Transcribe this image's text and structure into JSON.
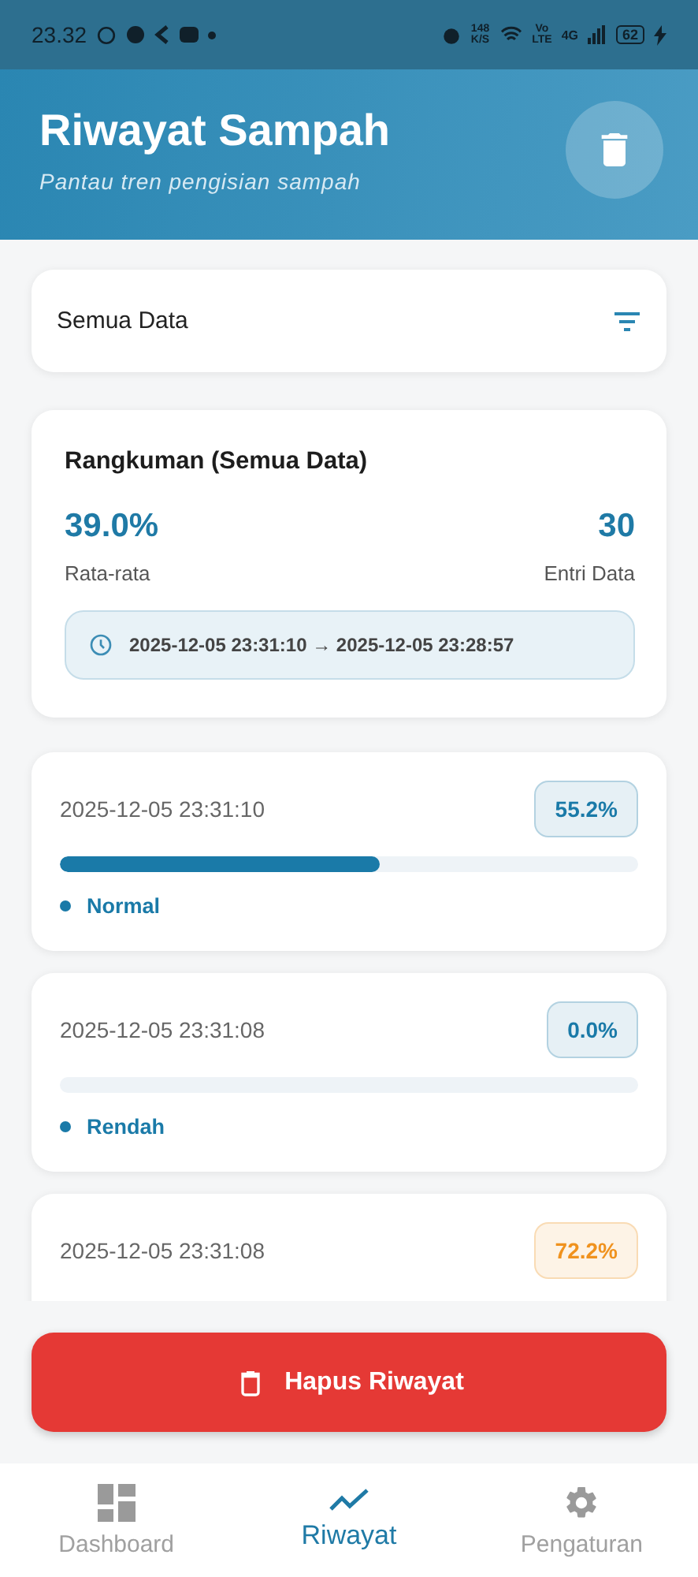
{
  "status_bar": {
    "time": "23.32",
    "speed": "148",
    "speed_unit": "K/S",
    "volte_top": "Vo",
    "volte_bottom": "LTE",
    "network": "4G",
    "battery": "62"
  },
  "header": {
    "title": "Riwayat Sampah",
    "subtitle": "Pantau tren pengisian sampah"
  },
  "filter": {
    "label": "Semua Data"
  },
  "summary": {
    "title": "Rangkuman (Semua Data)",
    "average": "39.0%",
    "average_label": "Rata-rata",
    "count": "30",
    "count_label": "Entri Data",
    "range": "2025-12-05 23:31:10 → 2025-12-05 23:28:57"
  },
  "entries": [
    {
      "time": "2025-12-05 23:31:10",
      "percent": "55.2%",
      "level": 0.552,
      "status": "Normal",
      "color": "#1a7aa8"
    },
    {
      "time": "2025-12-05 23:31:08",
      "percent": "0.0%",
      "level": 0,
      "status": "Rendah",
      "color": "#1a7aa8"
    },
    {
      "time": "2025-12-05 23:31:08",
      "percent": "72.2%",
      "color": "#f0921e"
    }
  ],
  "delete_button": {
    "label": "Hapus Riwayat"
  },
  "nav": [
    {
      "label": "Dashboard",
      "selected": false
    },
    {
      "label": "Riwayat",
      "selected": true
    },
    {
      "label": "Pengaturan",
      "selected": false
    }
  ]
}
